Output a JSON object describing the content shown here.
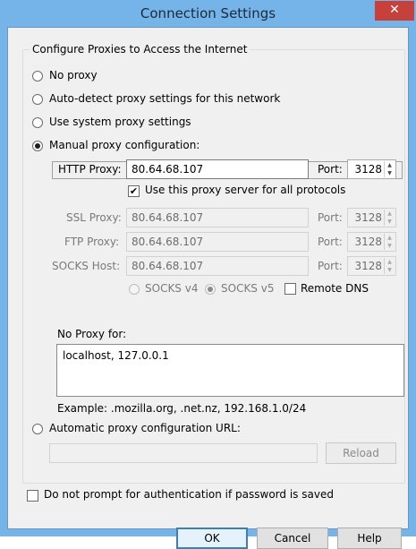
{
  "window": {
    "title": "Connection Settings",
    "close_label": "✕"
  },
  "group": {
    "label": "Configure Proxies to Access the Internet"
  },
  "options": {
    "no_proxy": "No proxy",
    "auto_detect": "Auto-detect proxy settings for this network",
    "system": "Use system proxy settings",
    "manual": "Manual proxy configuration:",
    "auto_url": "Automatic proxy configuration URL:"
  },
  "manual": {
    "http_label": "HTTP Proxy:",
    "http_value": "80.64.68.107",
    "port_label": "Port:",
    "http_port": "3128",
    "use_for_all": "Use this proxy server for all protocols",
    "ssl_label": "SSL Proxy:",
    "ssl_value": "80.64.68.107",
    "ssl_port": "3128",
    "ftp_label": "FTP Proxy:",
    "ftp_value": "80.64.68.107",
    "ftp_port": "3128",
    "socks_label": "SOCKS Host:",
    "socks_value": "80.64.68.107",
    "socks_port": "3128",
    "socks_v4": "SOCKS v4",
    "socks_v5": "SOCKS v5",
    "remote_dns": "Remote DNS",
    "no_proxy_label": "No Proxy for:",
    "no_proxy_value": "localhost, 127.0.0.1",
    "example": "Example: .mozilla.org, .net.nz, 192.168.1.0/24"
  },
  "auto_url": {
    "value": "",
    "reload": "Reload"
  },
  "footer": {
    "no_prompt": "Do not prompt for authentication if password is saved",
    "ok": "OK",
    "cancel": "Cancel",
    "help": "Help"
  }
}
